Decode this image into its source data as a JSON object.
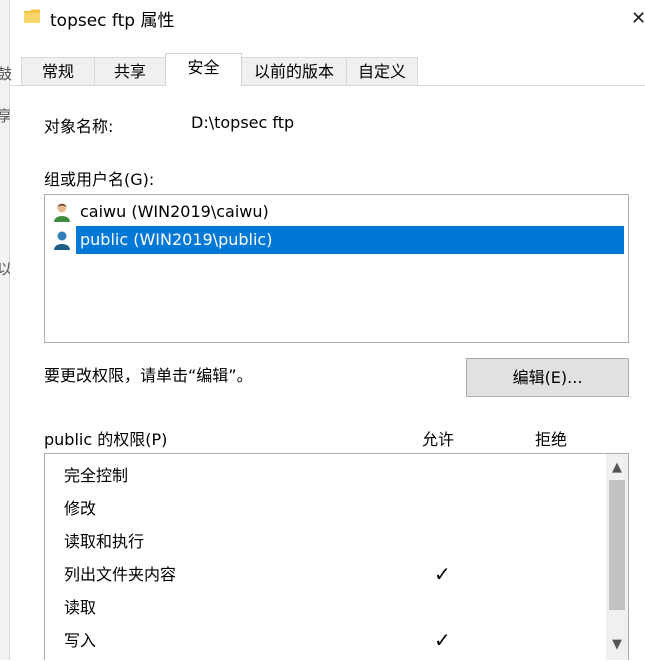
{
  "window": {
    "title": "topsec ftp 属性",
    "icon": "folder-icon",
    "close_icon": "close-icon"
  },
  "left_strip": {
    "glyphs": [
      "鼓",
      "享",
      "以"
    ]
  },
  "tabs": [
    {
      "label": "常规",
      "active": false
    },
    {
      "label": "共享",
      "active": false
    },
    {
      "label": "安全",
      "active": true
    },
    {
      "label": "以前的版本",
      "active": false
    },
    {
      "label": "自定义",
      "active": false
    }
  ],
  "security": {
    "object_name_label": "对象名称:",
    "object_name_value": "D:\\topsec ftp",
    "groups_label": "组或用户名(G):",
    "users": [
      {
        "name": "caiwu (WIN2019\\caiwu)",
        "selected": false,
        "icon": "user-icon"
      },
      {
        "name": "public (WIN2019\\public)",
        "selected": true,
        "icon": "user-icon"
      }
    ],
    "change_hint": "要更改权限，请单击“编辑”。",
    "edit_button": "编辑(E)...",
    "permissions_label": "public 的权限(P)",
    "allow_header": "允许",
    "deny_header": "拒绝",
    "permissions": [
      {
        "name": "完全控制",
        "allow": "",
        "deny": ""
      },
      {
        "name": "修改",
        "allow": "",
        "deny": ""
      },
      {
        "name": "读取和执行",
        "allow": "",
        "deny": ""
      },
      {
        "name": "列出文件夹内容",
        "allow": "✓",
        "deny": ""
      },
      {
        "name": "读取",
        "allow": "",
        "deny": ""
      },
      {
        "name": "写入",
        "allow": "✓",
        "deny": ""
      }
    ]
  },
  "colors": {
    "selection": "#0078d7",
    "button_bg": "#e1e1e1",
    "folder": "#f5c542",
    "user_caiwu": "#3f8b3f",
    "user_public": "#1e5d88"
  }
}
